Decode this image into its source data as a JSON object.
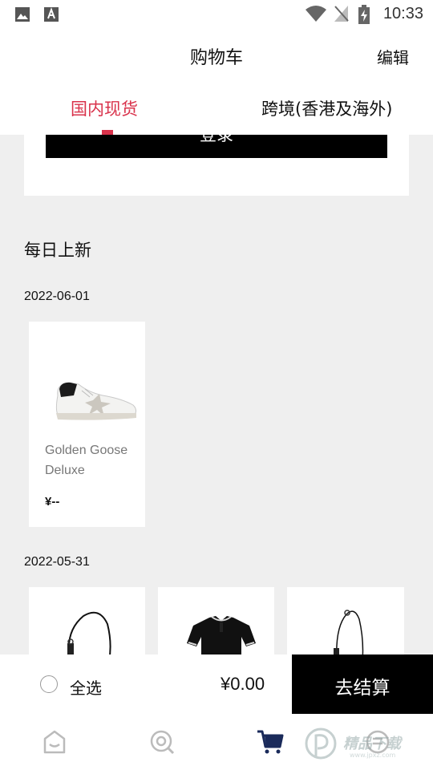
{
  "status_bar": {
    "time": "10:33"
  },
  "header": {
    "title": "购物车",
    "edit_label": "编辑"
  },
  "tabs": [
    {
      "label": "国内现货",
      "active": true
    },
    {
      "label": "跨境(香港及海外)",
      "active": false
    }
  ],
  "login": {
    "button_label": "登录"
  },
  "daily_new": {
    "title": "每日上新",
    "groups": [
      {
        "date": "2022-06-01",
        "products": [
          {
            "name": "Golden Goose Deluxe",
            "price": "¥--"
          }
        ]
      },
      {
        "date": "2022-05-31",
        "products": [
          {
            "image": "bag"
          },
          {
            "image": "polo-shirt"
          },
          {
            "image": "bag"
          }
        ]
      }
    ]
  },
  "checkout": {
    "select_all_label": "全选",
    "total": "¥0.00",
    "checkout_label": "去结算"
  },
  "bottom_nav": {
    "items": [
      "home-icon",
      "discover-icon",
      "cart-icon",
      "profile-icon"
    ],
    "active": "cart-icon"
  },
  "watermark": {
    "text": "精品下载",
    "sub": "www.jpxz.com"
  },
  "colors": {
    "accent": "#d9324b",
    "nav_active": "#1a2a5a"
  }
}
